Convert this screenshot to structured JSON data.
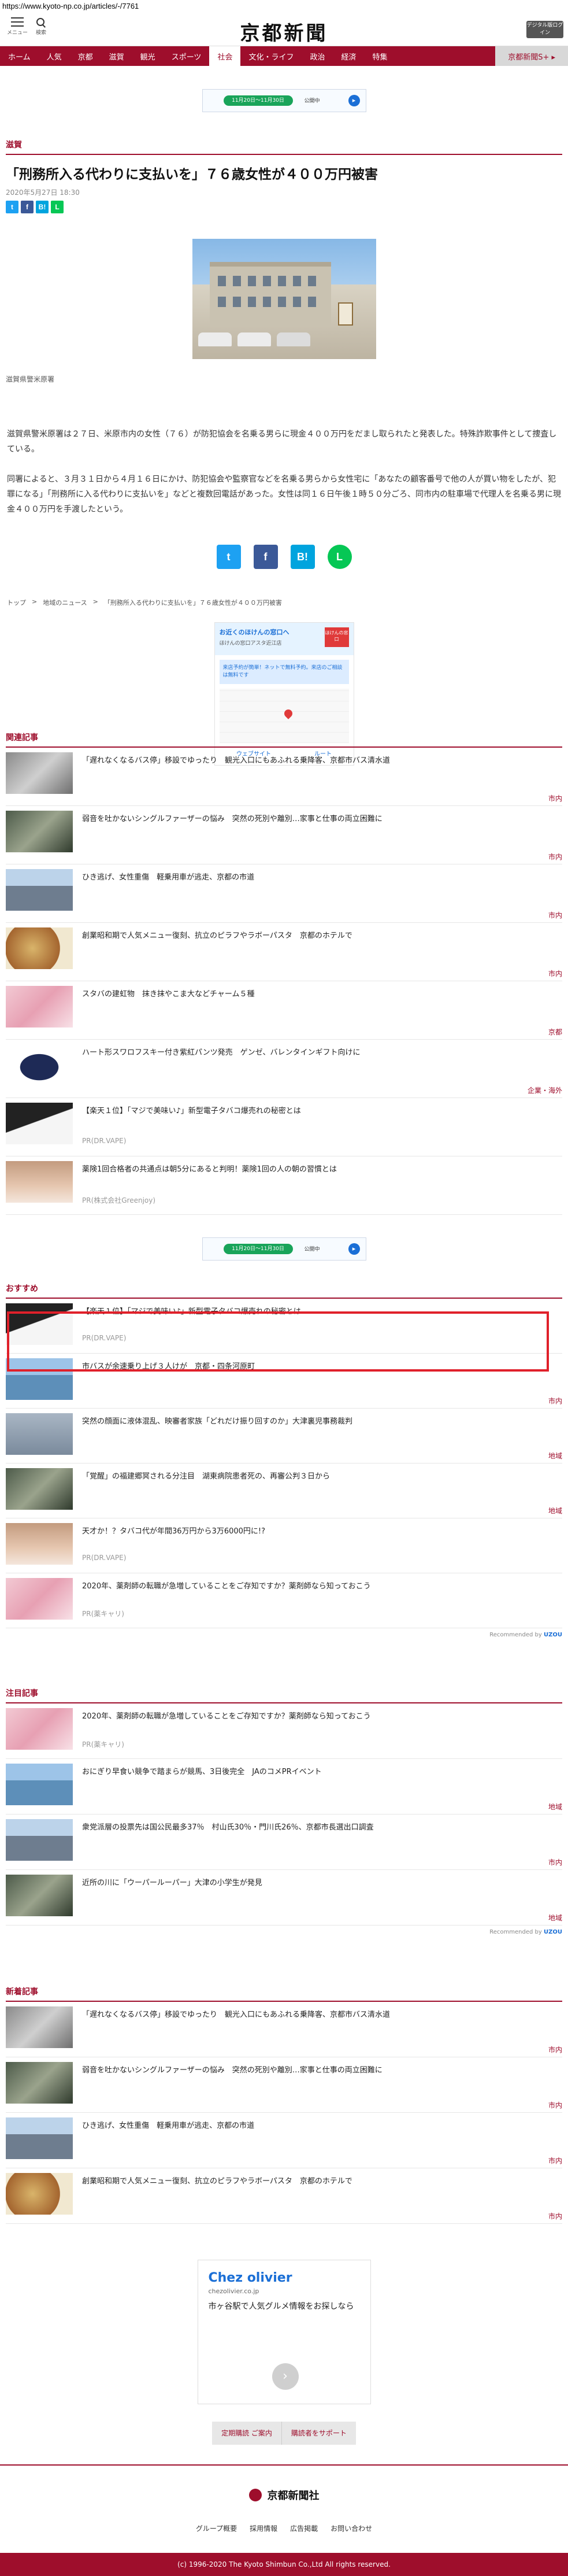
{
  "browser": {
    "url": "https://www.kyoto-np.co.jp/articles/-/7761"
  },
  "header": {
    "menu_label": "メニュー",
    "search_label": "検索",
    "logo": "京都新聞",
    "digital_btn": "デジタル版ログイン"
  },
  "nav": [
    {
      "label": "ホーム"
    },
    {
      "label": "人気"
    },
    {
      "label": "京都"
    },
    {
      "label": "滋賀"
    },
    {
      "label": "観光"
    },
    {
      "label": "スポーツ"
    },
    {
      "label": "社会"
    },
    {
      "label": "文化・ライフ"
    },
    {
      "label": "政治"
    },
    {
      "label": "経済"
    },
    {
      "label": "特集"
    },
    {
      "label": "京都新聞S+ ▸"
    }
  ],
  "ad_banner": {
    "pill": "11月20日～11月30日",
    "text": "公開中",
    "arrow": "▸"
  },
  "article": {
    "section": "滋賀",
    "headline": "「刑務所入る代わりに支払いを」７６歳女性が４００万円被害",
    "date": "2020年5月27日 18:30",
    "caption": "滋賀県警米原署",
    "para1": "滋賀県警米原署は２７日、米原市内の女性（７６）が防犯協会を名乗る男らに現金４００万円をだまし取られたと発表した。特殊詐欺事件として捜査している。",
    "para2": "同署によると、３月３１日から４月１６日にかけ、防犯協会や監察官などを名乗る男らから女性宅に「あなたの顧客番号で他の人が買い物をしたが、犯罪になる」「刑務所に入る代わりに支払いを」などと複数回電話があった。女性は同１６日午後１時５０分ごろ、同市内の駐車場で代理人を名乗る男に現金４００万円を手渡したという。"
  },
  "share": {
    "tw": "t",
    "fb": "f",
    "hb": "B!",
    "ln": "L"
  },
  "breadcrumb": [
    {
      "label": "トップ"
    },
    {
      "label": ">"
    },
    {
      "label": "地域のニュース"
    },
    {
      "label": ">"
    },
    {
      "label": "「刑務所入る代わりに支払いを」７６歳女性が４００万円被害"
    }
  ],
  "map_ad": {
    "title": "お近くのほけんの窓口へ",
    "sub": "ほけんの窓口アスタ近江店",
    "badge": "ほけんの窓口",
    "blue": "来店予約が簡単！ネットで無料予約。来店のご相談は無料です",
    "route": "ウェブサイト",
    "go": "ルート"
  },
  "related": {
    "label": "関連記事",
    "items": [
      {
        "title": "「遅れなくなるバス停」移設でゆったり　観光入口にもあふれる乗降客、京都市バス清水道",
        "tag": "市内"
      },
      {
        "title": "弱音を吐かないシングルファーザーの悩み　突然の死別や離別…家事と仕事の両立困難に",
        "tag": "市内"
      },
      {
        "title": "ひき逃げ、女性重傷　軽乗用車が逃走、京都の市道",
        "tag": "市内"
      },
      {
        "title": "創業昭和期で人気メニュー復刻、抗立のピラフやラボーパスタ　京都のホテルで",
        "tag": "市内"
      },
      {
        "title": "スタバの建虹物　抹き抹やこま大などチャーム５種",
        "tag": "京都"
      },
      {
        "title": "ハート形スワロフスキー付き紫紅パンツ発売　ゲンゼ、バレンタインギフト向けに",
        "tag": "企業・海外"
      },
      {
        "title": "【楽天１位】「マジで美味い♪」新型電子タバコ爆売れの秘密とは",
        "pr": "PR(DR.VAPE)"
      },
      {
        "title": "薬険1回合格者の共通点は朝5分にあると判明！薬険1回の人の朝の習慣とは",
        "pr": "PR(株式会社Greenjoy)"
      }
    ]
  },
  "ad_banner2": {
    "pill": "11月20日～11月30日",
    "text": "公開中",
    "arrow": "▸"
  },
  "recommend": {
    "label": "おすすめ",
    "items": [
      {
        "title": "【楽天１位】「マジで美味い♪」新型電子タバコ爆売れの秘密とは",
        "pr": "PR(DR.VAPE)"
      },
      {
        "title": "市バスが余速乗り上げ３人けが　京都・四条河原町",
        "tag": "市内"
      },
      {
        "title": "突然の顔面に液体混乱、映審者家族「どれだけ振り回すのか」大津裏児事務裁判",
        "tag": "地域"
      },
      {
        "title": "「覚醒」の福建郷冥される分注目　湖東病院患者死の、再審公判３日から",
        "tag": "地域"
      },
      {
        "title": "天才か！？タバコ代が年間36万円から3万6000円に!?",
        "pr": "PR(DR.VAPE)"
      },
      {
        "title": "2020年、薬剤師の転職が急増していることをご存知ですか？薬剤師なら知っておこう",
        "pr": "PR(薬キャリ)"
      }
    ],
    "powered": "Recommended by",
    "brand": "UZOU"
  },
  "attention": {
    "label": "注目記事",
    "items": [
      {
        "title": "2020年、薬剤師の転職が急増していることをご存知ですか？薬剤師なら知っておこう",
        "pr": "PR(薬キャリ)"
      },
      {
        "title": "おにぎり早食い競争で踏まらが競馬、3日後完全　JAのコメPRイベント",
        "tag": "地域"
      },
      {
        "title": "衆党派層の投票先は国公民最多37％　村山氏30％・門川氏26％、京都市長選出口調査",
        "tag": "市内"
      },
      {
        "title": "近所の川に「ウーパールーパー」大津の小学生が発見",
        "tag": "地域"
      }
    ],
    "powered": "Recommended by",
    "brand": "UZOU"
  },
  "latest": {
    "label": "新着記事",
    "items": [
      {
        "title": "「遅れなくなるバス停」移設でゆったり　観光入口にもあふれる乗降客、京都市バス清水道",
        "tag": "市内"
      },
      {
        "title": "弱音を吐かないシングルファーザーの悩み　突然の死別や離別…家事と仕事の両立困難に",
        "tag": "市内"
      },
      {
        "title": "ひき逃げ、女性重傷　軽乗用車が逃走、京都の市道",
        "tag": "市内"
      },
      {
        "title": "創業昭和期で人気メニュー復刻、抗立のピラフやラボーパスタ　京都のホテルで",
        "tag": "市内"
      }
    ]
  },
  "chez_ad": {
    "name": "Chez olivier",
    "url": "chezolivier.co.jp",
    "desc": "市ヶ谷駅で人気グルメ情報をお探しなら",
    "arrow": "›"
  },
  "support": {
    "left": "定期購読 ご案内",
    "right": "購読者をサポート"
  },
  "footer": {
    "logo": "京都新聞社",
    "links": [
      {
        "label": "グループ概要"
      },
      {
        "label": "採用情報"
      },
      {
        "label": "広告掲載"
      },
      {
        "label": "お問い合わせ"
      }
    ],
    "copyright": "(c) 1996-2020 The Kyoto Shimbun Co.,Ltd All rights reserved."
  }
}
